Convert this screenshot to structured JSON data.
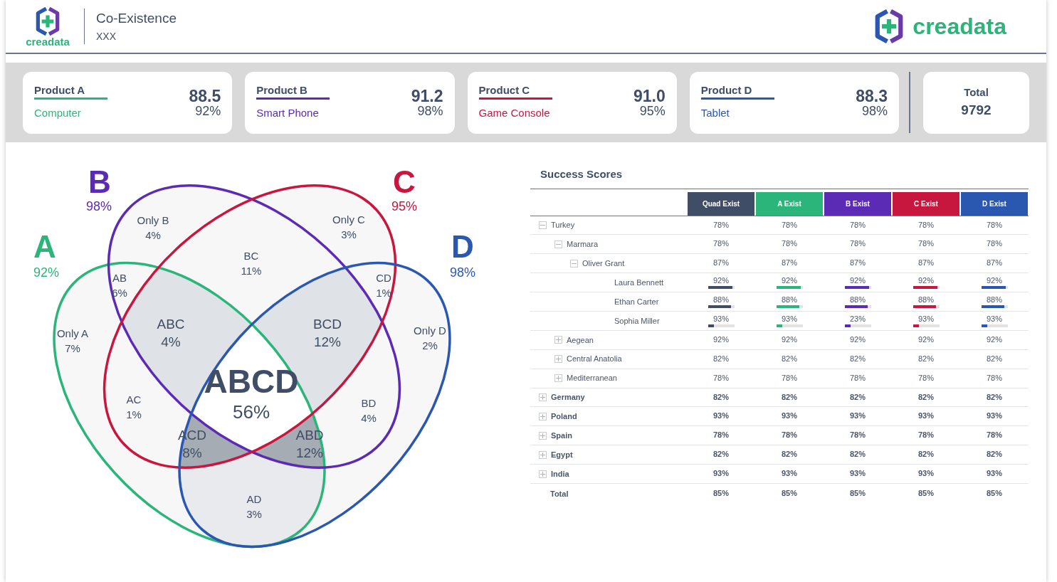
{
  "header": {
    "logo_text": "creadata",
    "title": "Co-Existence",
    "subtitle": "XXX",
    "right_logo_text": "creadata"
  },
  "products": [
    {
      "name": "Product A",
      "category": "Computer",
      "score": "88.5",
      "percent": "92%",
      "color": "#2bb57a"
    },
    {
      "name": "Product B",
      "category": "Smart Phone",
      "score": "91.2",
      "percent": "98%",
      "color": "#5b2bb5"
    },
    {
      "name": "Product C",
      "category": "Game Console",
      "score": "91.0",
      "percent": "95%",
      "color": "#c8173f"
    },
    {
      "name": "Product D",
      "category": "Tablet",
      "score": "88.3",
      "percent": "98%",
      "color": "#2a58b0"
    }
  ],
  "total": {
    "label": "Total",
    "value": "9792"
  },
  "venn": {
    "sets": [
      {
        "label": "A",
        "percent": "92%",
        "color": "#2bb57a"
      },
      {
        "label": "B",
        "percent": "98%",
        "color": "#5b2bb5"
      },
      {
        "label": "C",
        "percent": "95%",
        "color": "#c8173f"
      },
      {
        "label": "D",
        "percent": "98%",
        "color": "#2a58b0"
      }
    ],
    "regions": [
      {
        "label": "Only B",
        "value": "4%"
      },
      {
        "label": "Only C",
        "value": "3%"
      },
      {
        "label": "BC",
        "value": "11%"
      },
      {
        "label": "AB",
        "value": "6%"
      },
      {
        "label": "CD",
        "value": "1%"
      },
      {
        "label": "Only A",
        "value": "7%"
      },
      {
        "label": "ABC",
        "value": "4%"
      },
      {
        "label": "BCD",
        "value": "12%"
      },
      {
        "label": "Only D",
        "value": "2%"
      },
      {
        "label": "AC",
        "value": "1%"
      },
      {
        "label": "ABCD",
        "value": "56%"
      },
      {
        "label": "BD",
        "value": "4%"
      },
      {
        "label": "ACD",
        "value": "8%"
      },
      {
        "label": "ABD",
        "value": "12%"
      },
      {
        "label": "AD",
        "value": "3%"
      }
    ]
  },
  "table": {
    "title": "Success Scores",
    "columns": [
      {
        "label": "Quad Exist",
        "color": "#3f4d66"
      },
      {
        "label": "A Exist",
        "color": "#2bb57a"
      },
      {
        "label": "B Exist",
        "color": "#5b2bb5"
      },
      {
        "label": "C Exist",
        "color": "#c8173f"
      },
      {
        "label": "D Exist",
        "color": "#2a58b0"
      }
    ],
    "rows": [
      {
        "label": "Turkey",
        "expanded": true,
        "cells": [
          {
            "text": "78%"
          },
          {
            "text": "78%"
          },
          {
            "text": "78%"
          },
          {
            "text": "78%"
          },
          {
            "text": "78%"
          }
        ],
        "children": [
          {
            "label": "Marmara",
            "expanded": true,
            "cells": [
              {
                "text": "78%"
              },
              {
                "text": "78%"
              },
              {
                "text": "78%"
              },
              {
                "text": "78%"
              },
              {
                "text": "78%"
              }
            ],
            "children": [
              {
                "label": "Oliver Grant",
                "expanded": true,
                "cells": [
                  {
                    "text": "87%"
                  },
                  {
                    "text": "87%"
                  },
                  {
                    "text": "87%"
                  },
                  {
                    "text": "87%"
                  },
                  {
                    "text": "87%"
                  }
                ],
                "children": [
                  {
                    "label": "Laura Bennett",
                    "cells": [
                      {
                        "text": "92%",
                        "level": 0.92
                      },
                      {
                        "text": "92%",
                        "level": 0.92
                      },
                      {
                        "text": "92%",
                        "level": 0.92
                      },
                      {
                        "text": "92%",
                        "level": 0.92
                      },
                      {
                        "text": "92%",
                        "level": 0.92
                      }
                    ]
                  },
                  {
                    "label": "Ethan Carter",
                    "cells": [
                      {
                        "text": "88%",
                        "level": 0.88
                      },
                      {
                        "text": "88%",
                        "level": 0.88
                      },
                      {
                        "text": "88%",
                        "level": 0.88
                      },
                      {
                        "text": "88%",
                        "level": 0.88
                      },
                      {
                        "text": "88%",
                        "level": 0.88
                      }
                    ]
                  },
                  {
                    "label": "Sophia Miller",
                    "cells": [
                      {
                        "text": "93%",
                        "level": 0.22
                      },
                      {
                        "text": "93%",
                        "level": 0.22
                      },
                      {
                        "text": "23%",
                        "level": 0.23
                      },
                      {
                        "text": "93%",
                        "level": 0.22
                      },
                      {
                        "text": "93%",
                        "level": 0.22
                      }
                    ]
                  }
                ]
              }
            ]
          },
          {
            "label": "Aegean",
            "expanded": false,
            "cells": [
              {
                "text": "92%"
              },
              {
                "text": "92%"
              },
              {
                "text": "92%"
              },
              {
                "text": "92%"
              },
              {
                "text": "92%"
              }
            ]
          },
          {
            "label": "Central Anatolia",
            "expanded": false,
            "cells": [
              {
                "text": "82%"
              },
              {
                "text": "82%"
              },
              {
                "text": "82%"
              },
              {
                "text": "82%"
              },
              {
                "text": "82%"
              }
            ]
          },
          {
            "label": "Mediterranean",
            "expanded": false,
            "cells": [
              {
                "text": "78%"
              },
              {
                "text": "78%"
              },
              {
                "text": "78%"
              },
              {
                "text": "78%"
              },
              {
                "text": "78%"
              }
            ]
          }
        ]
      },
      {
        "label": "Germany",
        "expanded": false,
        "cells": [
          {
            "text": "82%"
          },
          {
            "text": "82%"
          },
          {
            "text": "82%"
          },
          {
            "text": "82%"
          },
          {
            "text": "82%"
          }
        ]
      },
      {
        "label": "Poland",
        "expanded": false,
        "cells": [
          {
            "text": "93%"
          },
          {
            "text": "93%"
          },
          {
            "text": "93%"
          },
          {
            "text": "93%"
          },
          {
            "text": "93%"
          }
        ]
      },
      {
        "label": "Spain",
        "expanded": false,
        "cells": [
          {
            "text": "78%"
          },
          {
            "text": "78%"
          },
          {
            "text": "78%"
          },
          {
            "text": "78%"
          },
          {
            "text": "78%"
          }
        ]
      },
      {
        "label": "Egypt",
        "expanded": false,
        "cells": [
          {
            "text": "82%"
          },
          {
            "text": "82%"
          },
          {
            "text": "82%"
          },
          {
            "text": "82%"
          },
          {
            "text": "82%"
          }
        ]
      },
      {
        "label": "India",
        "expanded": false,
        "cells": [
          {
            "text": "93%"
          },
          {
            "text": "93%"
          },
          {
            "text": "93%"
          },
          {
            "text": "93%"
          },
          {
            "text": "93%"
          }
        ]
      }
    ],
    "total": {
      "label": "Total",
      "cells": [
        {
          "text": "85%"
        },
        {
          "text": "85%"
        },
        {
          "text": "85%"
        },
        {
          "text": "85%"
        },
        {
          "text": "85%"
        }
      ]
    }
  }
}
